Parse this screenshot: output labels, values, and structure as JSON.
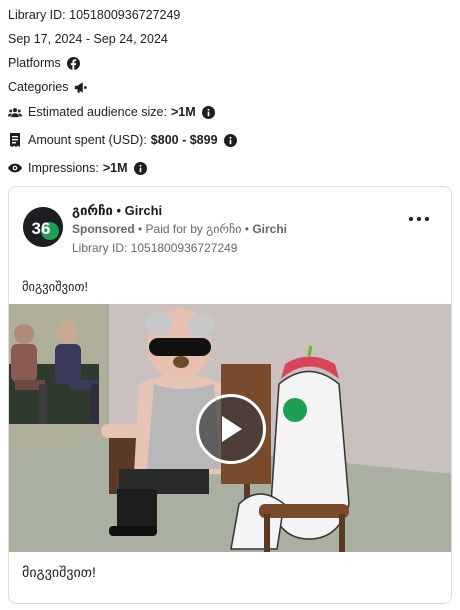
{
  "library_id": "Library ID: 1051800936727249",
  "date_range": "Sep 17, 2024 - Sep 24, 2024",
  "platforms_label": "Platforms",
  "categories_label": "Categories",
  "audience": {
    "label": "Estimated audience size:",
    "value": ">1M"
  },
  "spent": {
    "label": "Amount spent (USD):",
    "value": "$800 - $899"
  },
  "impressions": {
    "label": "Impressions:",
    "value": ">1M"
  },
  "ad": {
    "page_name": "გირჩი • Girchi",
    "sponsored": "Sponsored",
    "paid_for_prefix": " • Paid for by გირჩი • ",
    "paid_for_name": "Girchi",
    "library_id": "Library ID: 1051800936727249",
    "body_text": "მიგვიშვით!",
    "caption": "მიგვიშვით!",
    "avatar_text": "36"
  },
  "colors": {
    "text": "#1c1e21",
    "muted": "#65676b",
    "border": "#dadde1",
    "brand_green": "#1e9e57"
  },
  "icons": [
    "facebook-icon",
    "megaphone-icon",
    "people-icon",
    "info-icon",
    "receipt-icon",
    "eye-icon",
    "play-icon",
    "more-icon"
  ]
}
